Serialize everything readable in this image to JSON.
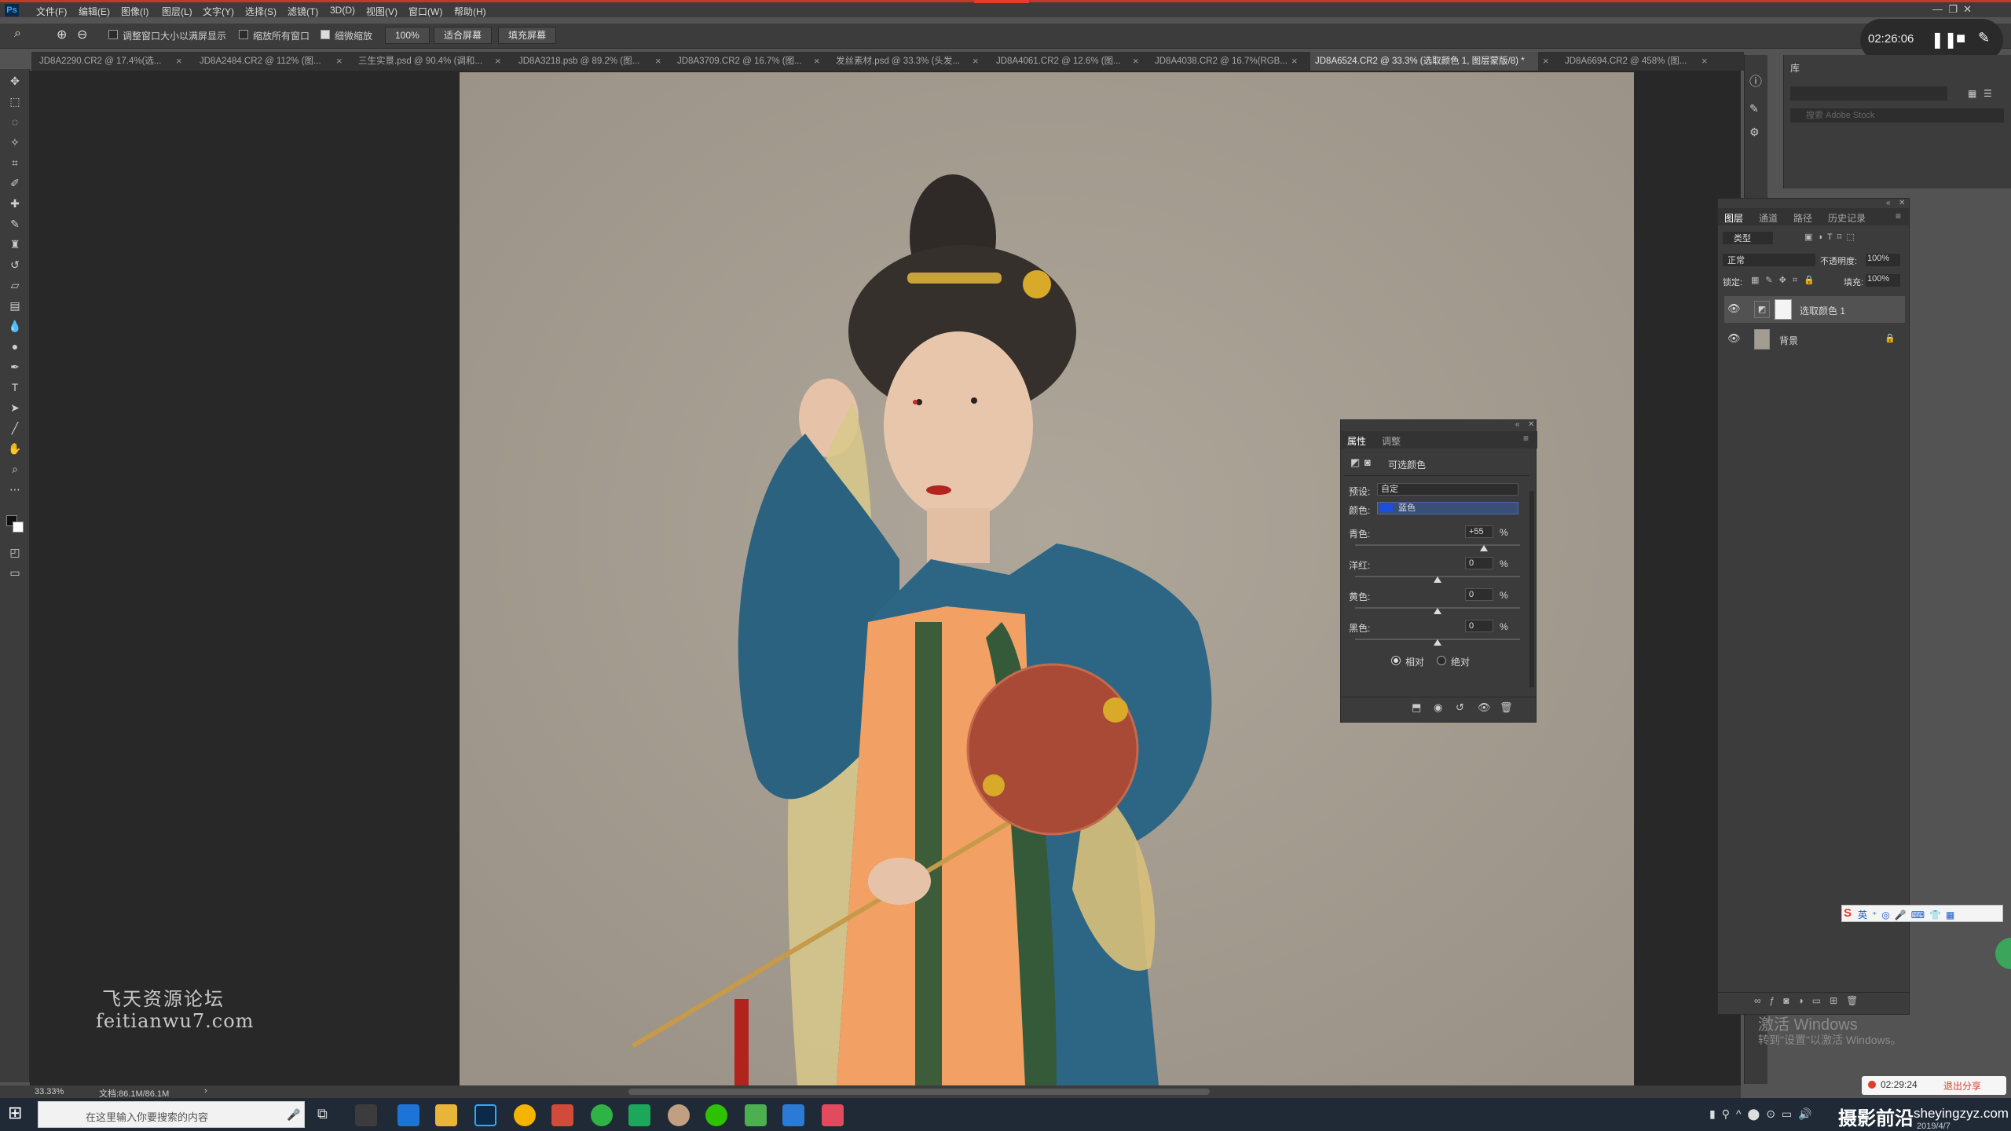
{
  "app": {
    "logo": "Ps"
  },
  "menu": [
    "文件(F)",
    "编辑(E)",
    "图像(I)",
    "图层(L)",
    "文字(Y)",
    "选择(S)",
    "滤镜(T)",
    "3D(D)",
    "视图(V)",
    "窗口(W)",
    "帮助(H)"
  ],
  "options": {
    "resize_windows": "调整窗口大小以满屏显示",
    "zoom_all": "缩放所有窗口",
    "scrubby_zoom": "细微缩放",
    "zoom_value": "100%",
    "fit_screen": "适合屏幕",
    "fill_screen": "填充屏幕"
  },
  "recording": {
    "time": "02:26:06"
  },
  "tabs": [
    {
      "label": "JD8A2290.CR2 @ 17.4%(选..."
    },
    {
      "label": "JD8A2484.CR2 @ 112% (图..."
    },
    {
      "label": "三生实景.psd @ 90.4% (调和..."
    },
    {
      "label": "JD8A3218.psb @ 89.2% (图..."
    },
    {
      "label": "JD8A3709.CR2 @ 16.7% (图..."
    },
    {
      "label": "发丝素材.psd @ 33.3% (头发..."
    },
    {
      "label": "JD8A4061.CR2 @ 12.6% (图..."
    },
    {
      "label": "JD8A4038.CR2 @ 16.7%(RGB..."
    },
    {
      "label": "JD8A6524.CR2 @ 33.3% (选取颜色 1, 图层蒙版/8) *"
    },
    {
      "label": "JD8A6694.CR2 @ 458% (图..."
    }
  ],
  "properties": {
    "tab_props": "属性",
    "tab_adjust": "调整",
    "title": "可选颜色",
    "preset_label": "预设:",
    "preset_value": "自定",
    "colors_label": "颜色:",
    "colors_value": "蓝色",
    "cyan_label": "青色:",
    "cyan_value": "+55",
    "magenta_label": "洋红:",
    "magenta_value": "0",
    "yellow_label": "黄色:",
    "yellow_value": "0",
    "black_label": "黑色:",
    "black_value": "0",
    "pct": "%",
    "relative": "相对",
    "absolute": "绝对",
    "cyan_level": 0.78
  },
  "layers_panel": {
    "tabs": [
      "图层",
      "通道",
      "路径",
      "历史记录"
    ],
    "kind": "类型",
    "blend": "正常",
    "opacity_label": "不透明度:",
    "opacity_value": "100%",
    "lock_label": "锁定:",
    "fill_label": "填充:",
    "fill_value": "100%",
    "layers": [
      {
        "name": "选取颜色 1"
      },
      {
        "name": "背景"
      }
    ]
  },
  "libraries": {
    "search_placeholder": "搜索 Adobe Stock"
  },
  "watermark": {
    "cn": "飞天资源论坛",
    "url": "feitianwu7.com"
  },
  "status": {
    "zoom": "33.33%",
    "doc": "文档:86.1M/86.1M"
  },
  "activate": {
    "line1": "激活 Windows",
    "line2": "转到\"设置\"以激活 Windows。"
  },
  "share": {
    "time": "02:29:24",
    "exit": "退出分享"
  },
  "taskbar": {
    "search": "在这里输入你要搜索的内容",
    "brand": "摄影前沿",
    "site": "sheyingzyz.com",
    "date": "2019/4/7"
  }
}
